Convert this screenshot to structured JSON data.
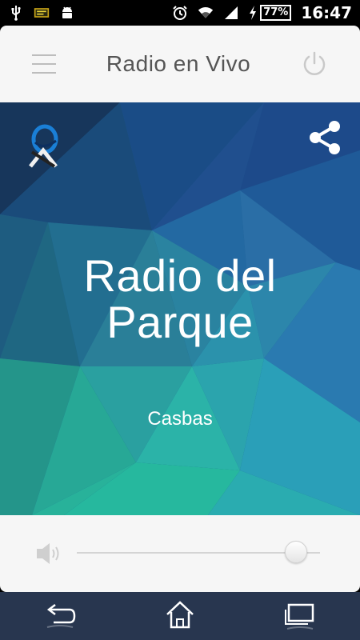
{
  "status_bar": {
    "battery_percent": "77%",
    "time": "16:47",
    "icons": [
      "usb-icon",
      "notification-app-icon",
      "android-icon",
      "alarm-icon",
      "wifi-icon",
      "signal-icon",
      "charging-icon",
      "battery-icon"
    ]
  },
  "header": {
    "title": "Radio en Vivo",
    "icons": [
      "menu-icon",
      "power-icon"
    ]
  },
  "station": {
    "name_line1": "Radio del",
    "name_line2": "Parque",
    "city": "Casbas",
    "icons": [
      "station-logo",
      "share-icon"
    ]
  },
  "volume": {
    "level": 0.9,
    "icon": "speaker-icon"
  },
  "nav": {
    "icons": [
      "back-icon",
      "home-icon",
      "recent-apps-icon"
    ]
  },
  "colors": {
    "header_bg": "#f6f6f6",
    "nav_bg": "#28364f",
    "hero_dark": "#1d4a8a",
    "hero_teal": "#27b39c"
  }
}
